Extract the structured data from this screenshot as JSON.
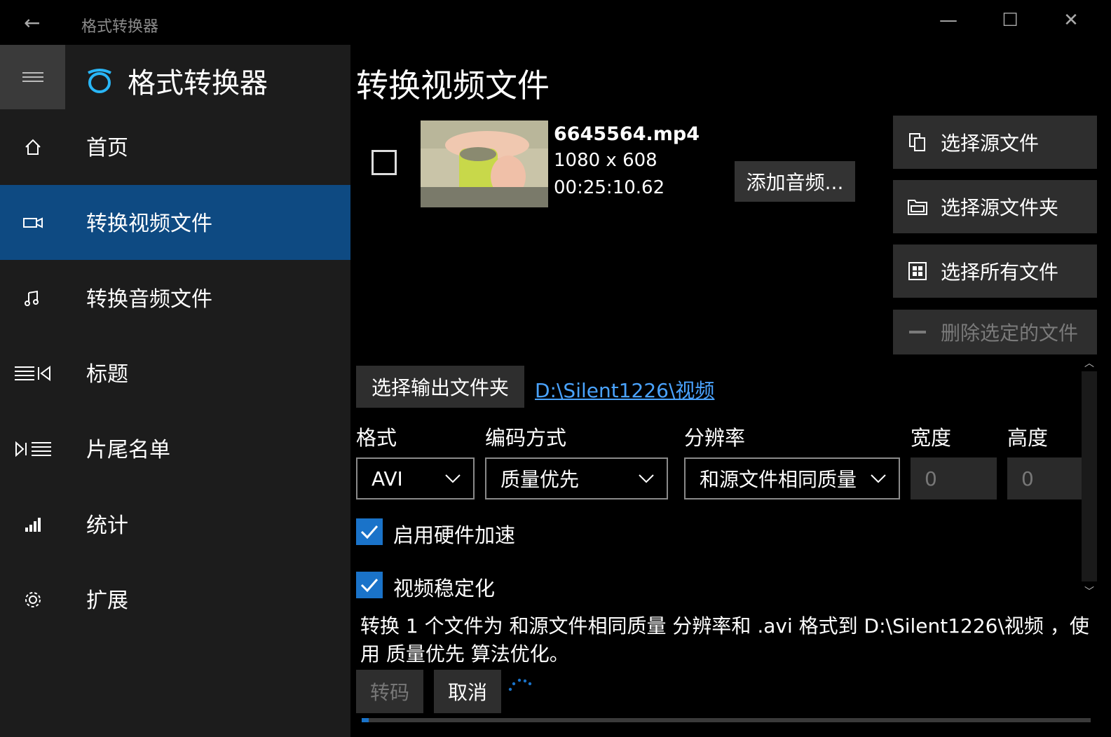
{
  "window": {
    "title": "格式转换器",
    "minimize_label": "—",
    "maximize_label": "☐",
    "close_label": "✕"
  },
  "sidebar": {
    "app_name": "格式转换器",
    "items": [
      {
        "label": "首页",
        "icon": "home-icon"
      },
      {
        "label": "转换视频文件",
        "icon": "video-icon",
        "selected": true
      },
      {
        "label": "转换音频文件",
        "icon": "music-icon"
      },
      {
        "label": "标题",
        "icon": "title-icon"
      },
      {
        "label": "片尾名单",
        "icon": "credits-icon"
      },
      {
        "label": "统计",
        "icon": "stats-icon"
      },
      {
        "label": "扩展",
        "icon": "gear-icon"
      }
    ]
  },
  "main": {
    "page_title": "转换视频文件",
    "file": {
      "name": "6645564.mp4",
      "resolution": "1080 x 608",
      "duration": "00:25:10.62",
      "checked": false
    },
    "add_audio_label": "添加音频...",
    "side_buttons": [
      {
        "label": "选择源文件",
        "icon": "copy-icon"
      },
      {
        "label": "选择源文件夹",
        "icon": "folder-icon"
      },
      {
        "label": "选择所有文件",
        "icon": "select-all-icon"
      },
      {
        "label": "删除选定的文件",
        "icon": "minus-icon",
        "disabled": true
      }
    ],
    "output_folder_button": "选择输出文件夹",
    "output_path": "D:\\Silent1226\\视频",
    "fields": {
      "format_label": "格式",
      "format_value": "AVI",
      "encoding_label": "编码方式",
      "encoding_value": "质量优先",
      "resolution_label": "分辨率",
      "resolution_value": "和源文件相同质量",
      "width_label": "宽度",
      "width_value": "0",
      "height_label": "高度",
      "height_value": "0"
    },
    "hardware_accel_label": "启用硬件加速",
    "stabilization_label": "视频稳定化",
    "summary": "转换 1 个文件为 和源文件相同质量 分辨率和 .avi 格式到 D:\\Silent1226\\视频 ，使用 质量优先 算法优化。",
    "transcode_label": "转码",
    "cancel_label": "取消",
    "progress": 0.01
  },
  "colors": {
    "accent": "#1a73c9",
    "nav_selected": "#0e4a82",
    "link": "#4aa3ff"
  }
}
